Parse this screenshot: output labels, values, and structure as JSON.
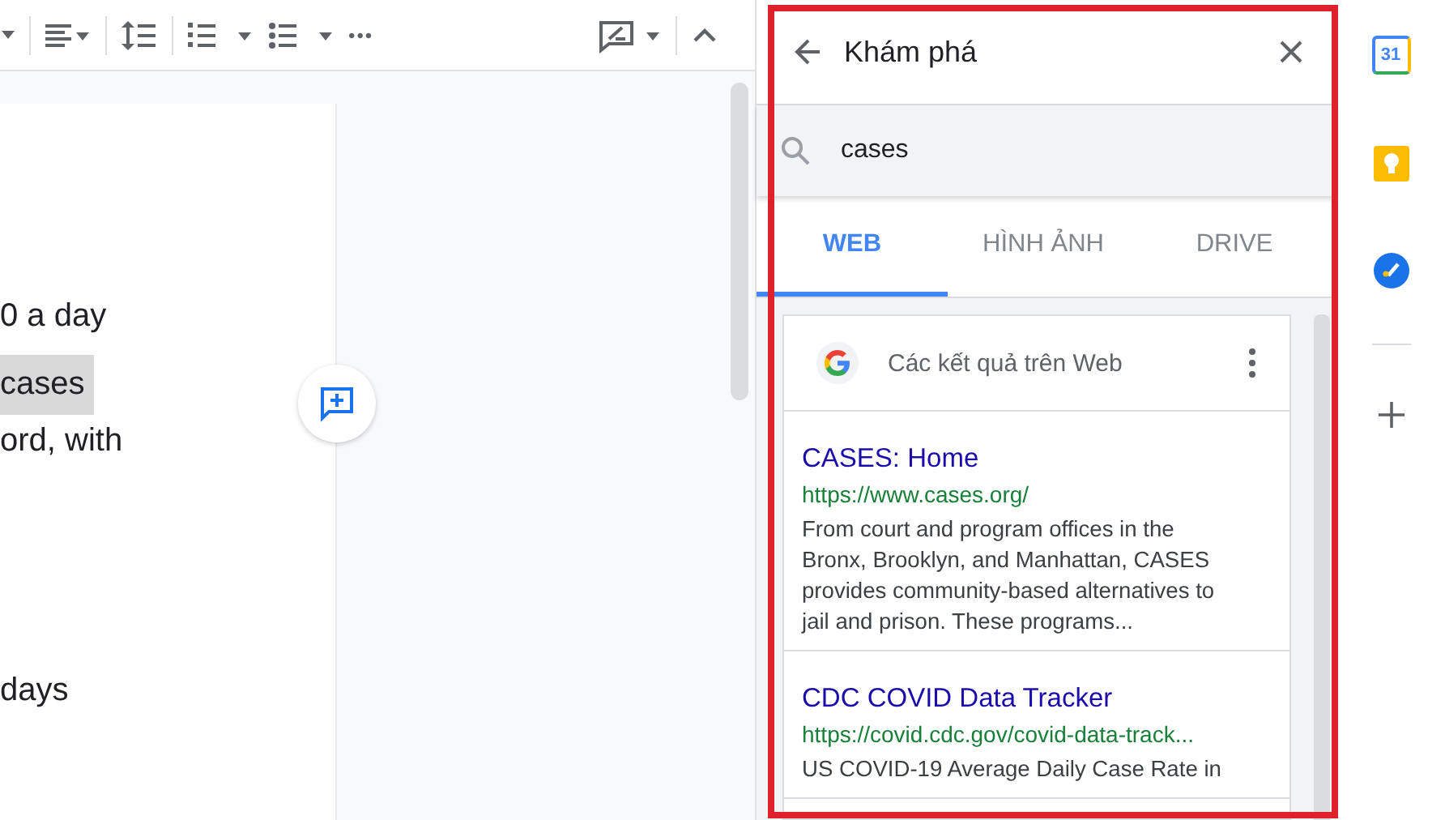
{
  "toolbar": {
    "buttons": [
      {
        "kind": "caret"
      },
      {
        "kind": "align"
      },
      {
        "kind": "spacing"
      },
      {
        "kind": "numbered"
      },
      {
        "kind": "bulleted"
      },
      {
        "kind": "more",
        "label": "•••"
      },
      {
        "kind": "image"
      },
      {
        "kind": "collapse"
      }
    ]
  },
  "document": {
    "lines": [
      {
        "text": "0 a day",
        "highlighted": false
      },
      {
        "text": "cases",
        "highlighted": true
      },
      {
        "text": "ord, with",
        "highlighted": false
      },
      {
        "text": "days",
        "highlighted": false
      }
    ]
  },
  "panel": {
    "title": "Khám phá",
    "search": {
      "value": "cases"
    },
    "tabs": [
      {
        "label": "WEB",
        "selected": true
      },
      {
        "label": "HÌNH ẢNH",
        "selected": false
      },
      {
        "label": "DRIVE",
        "selected": false
      }
    ],
    "results_header": "Các kết quả trên Web",
    "results": [
      {
        "title": "CASES: Home",
        "url": "https://www.cases.org/",
        "snippet": "From court and program offices in the Bronx, Brooklyn, and Manhattan, CASES provides community-based alternatives to jail and prison. These programs..."
      },
      {
        "title": "CDC COVID Data Tracker",
        "url": "https://covid.cdc.gov/covid-data-track...",
        "snippet": "US COVID-19 Average Daily Case Rate in"
      }
    ]
  },
  "rail": {
    "apps": [
      {
        "kind": "calendar",
        "label": "31"
      },
      {
        "kind": "keep"
      },
      {
        "kind": "tasks"
      }
    ]
  }
}
